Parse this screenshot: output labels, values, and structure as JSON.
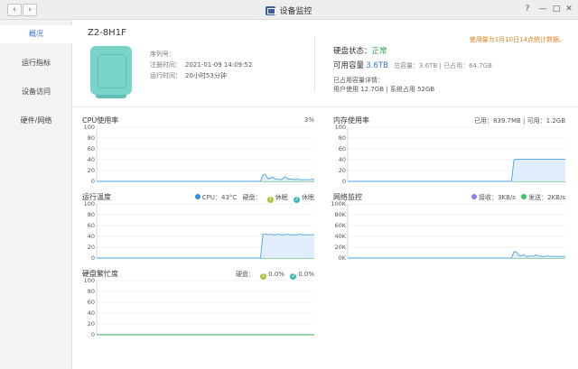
{
  "window": {
    "title": "设备监控",
    "back_glyph": "‹",
    "forward_glyph": "›",
    "help_glyph": "?",
    "minimize_glyph": "—",
    "maximize_glyph": "□",
    "close_glyph": "✕"
  },
  "sidebar": {
    "items": [
      {
        "label": "概况",
        "active": true
      },
      {
        "label": "运行指标",
        "active": false
      },
      {
        "label": "设备访问",
        "active": false
      },
      {
        "label": "硬件/网络",
        "active": false
      }
    ]
  },
  "device": {
    "name": "Z2-8H1F",
    "serial_label": "序列号：",
    "serial_value": "",
    "registered_label": "注册时间：",
    "registered_value": "2021-01-09 14:09:52",
    "uptime_label": "运行时间：",
    "uptime_value": "20小时53分钟"
  },
  "disk": {
    "status_label": "硬盘状态：",
    "status_value": "正常",
    "capacity_label": "可用容量",
    "capacity_value": "3.6TB",
    "total_label": "总容量：",
    "total_value": "3.6TB",
    "used_label": "已占用：",
    "used_value": "64.7GB",
    "detail_label": "已占用容量详情：",
    "user_used": "用户使用 12.7GB",
    "sys_used": "系统占用 52GB"
  },
  "notice": "使用量为1月10日14点统计数据。",
  "colors": {
    "accent": "#2f6fd6",
    "ok": "#2da44e",
    "notice": "#e48321",
    "line": "#4aa3df",
    "fill": "#dfeefa",
    "recv": "#8a7fe8",
    "send": "#34c759"
  },
  "charts": {
    "cpu": {
      "title": "CPU使用率",
      "current": "3%"
    },
    "mem": {
      "title": "内存使用率",
      "used_label": "已用：",
      "used_value": "839.7MB",
      "avail_label": "可用：",
      "avail_value": "1.2GB"
    },
    "temp": {
      "title": "运行温度",
      "cpu_label": "CPU：",
      "cpu_value": "43°C",
      "disk_label": "硬盘：",
      "disk1_state": "休眠",
      "disk2_state": "休眠",
      "disk1_badge": "1",
      "disk2_badge": "2"
    },
    "net": {
      "title": "网络监控",
      "recv_label": "接收：",
      "recv_value": "3KB/s",
      "send_label": "发送：",
      "send_value": "2KB/s"
    },
    "busy": {
      "title": "硬盘繁忙度",
      "disk_label": "硬盘：",
      "disk1_value": "0.0%",
      "disk2_value": "0.0%",
      "disk1_badge": "1",
      "disk2_badge": "2"
    }
  },
  "chart_data": [
    {
      "type": "area",
      "title": "CPU使用率",
      "ylim": [
        0,
        100
      ],
      "yticks": [
        "0",
        "20",
        "40",
        "60",
        "80",
        "100"
      ],
      "series": [
        {
          "values": [
            0,
            0,
            0,
            0,
            0,
            0,
            0,
            0,
            0,
            0,
            0,
            0,
            0,
            0,
            0,
            0,
            0,
            0,
            0,
            0,
            0,
            0,
            0,
            0,
            0,
            0,
            0,
            0,
            0,
            0,
            0,
            0,
            0,
            0,
            0,
            0,
            0,
            0,
            0,
            0,
            0,
            0,
            0,
            0,
            0,
            0,
            0,
            0,
            0,
            0,
            0,
            0,
            0,
            0,
            0,
            0,
            0,
            0,
            0,
            0,
            0,
            0,
            0,
            0,
            0,
            0,
            0,
            0,
            12,
            13,
            5,
            6,
            8,
            4,
            4,
            3,
            4,
            9,
            5,
            4,
            4,
            3,
            4,
            3,
            3,
            3,
            3,
            3,
            4,
            3
          ]
        }
      ]
    },
    {
      "type": "area",
      "title": "内存使用率",
      "ylim": [
        0,
        100
      ],
      "yticks": [
        "0",
        "20",
        "40",
        "60",
        "80",
        "100"
      ],
      "series": [
        {
          "values": [
            0,
            0,
            0,
            0,
            0,
            0,
            0,
            0,
            0,
            0,
            0,
            0,
            0,
            0,
            0,
            0,
            0,
            0,
            0,
            0,
            0,
            0,
            0,
            0,
            0,
            0,
            0,
            0,
            0,
            0,
            0,
            0,
            0,
            0,
            0,
            0,
            0,
            0,
            0,
            0,
            0,
            0,
            0,
            0,
            0,
            0,
            0,
            0,
            0,
            0,
            0,
            0,
            0,
            0,
            0,
            0,
            0,
            0,
            0,
            0,
            0,
            0,
            0,
            0,
            0,
            0,
            0,
            0,
            40,
            41,
            41,
            41,
            41,
            41,
            41,
            41,
            41,
            41,
            41,
            41,
            41,
            41,
            41,
            41,
            41,
            41,
            41,
            41,
            41,
            41
          ]
        }
      ]
    },
    {
      "type": "area",
      "title": "运行温度",
      "ylim": [
        0,
        100
      ],
      "yticks": [
        "0",
        "20",
        "40",
        "60",
        "80",
        "100"
      ],
      "series": [
        {
          "name": "CPU",
          "values": [
            0,
            0,
            0,
            0,
            0,
            0,
            0,
            0,
            0,
            0,
            0,
            0,
            0,
            0,
            0,
            0,
            0,
            0,
            0,
            0,
            0,
            0,
            0,
            0,
            0,
            0,
            0,
            0,
            0,
            0,
            0,
            0,
            0,
            0,
            0,
            0,
            0,
            0,
            0,
            0,
            0,
            0,
            0,
            0,
            0,
            0,
            0,
            0,
            0,
            0,
            0,
            0,
            0,
            0,
            0,
            0,
            0,
            0,
            0,
            0,
            0,
            0,
            0,
            0,
            0,
            0,
            0,
            0,
            44,
            44,
            43,
            44,
            43,
            43,
            44,
            43,
            43,
            43,
            44,
            43,
            43,
            43,
            43,
            44,
            43,
            43,
            43,
            43,
            43,
            43
          ]
        }
      ]
    },
    {
      "type": "area",
      "title": "网络监控",
      "ylim": [
        0,
        100
      ],
      "yticks": [
        "0K",
        "20K",
        "40K",
        "60K",
        "80K",
        "100K"
      ],
      "series": [
        {
          "name": "接收",
          "values": [
            0,
            0,
            0,
            0,
            0,
            0,
            0,
            0,
            0,
            0,
            0,
            0,
            0,
            0,
            0,
            0,
            0,
            0,
            0,
            0,
            0,
            0,
            0,
            0,
            0,
            0,
            0,
            0,
            0,
            0,
            0,
            0,
            0,
            0,
            0,
            0,
            0,
            0,
            0,
            0,
            0,
            0,
            0,
            0,
            0,
            0,
            0,
            0,
            0,
            0,
            0,
            0,
            0,
            0,
            0,
            0,
            0,
            0,
            0,
            0,
            0,
            0,
            0,
            0,
            0,
            0,
            0,
            0,
            12,
            11,
            5,
            4,
            6,
            3,
            3,
            4,
            3,
            6,
            4,
            3,
            3,
            3,
            4,
            3,
            3,
            3,
            3,
            3,
            3,
            3
          ]
        }
      ]
    },
    {
      "type": "area",
      "title": "硬盘繁忙度",
      "ylim": [
        0,
        100
      ],
      "yticks": [
        "0",
        "20",
        "40",
        "60",
        "80",
        "100"
      ],
      "series": [
        {
          "values": [
            0,
            0,
            0,
            0,
            0,
            0,
            0,
            0,
            0,
            0,
            0,
            0,
            0,
            0,
            0,
            0,
            0,
            0,
            0,
            0,
            0,
            0,
            0,
            0,
            0,
            0,
            0,
            0,
            0,
            0,
            0,
            0,
            0,
            0,
            0,
            0,
            0,
            0,
            0,
            0,
            0,
            0,
            0,
            0,
            0,
            0,
            0,
            0,
            0,
            0,
            0,
            0,
            0,
            0,
            0,
            0,
            0,
            0,
            0,
            0,
            0,
            0,
            0,
            0,
            0,
            0,
            0,
            0,
            0,
            0,
            0,
            0,
            0,
            0,
            0,
            0,
            0,
            0,
            0,
            0,
            0,
            0,
            0,
            0,
            0,
            0,
            0,
            0,
            0,
            0
          ]
        }
      ]
    }
  ]
}
